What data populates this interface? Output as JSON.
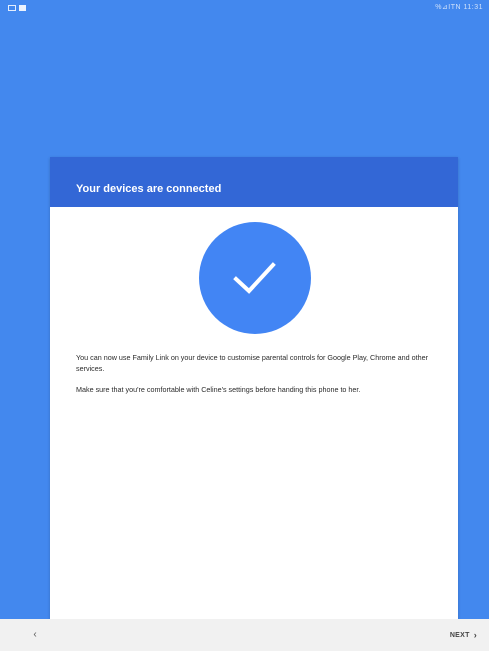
{
  "status_bar": {
    "right_text": "%⊿ITN 11:31",
    "left_icons": [
      "gallery-icon",
      "folder-icon"
    ]
  },
  "card": {
    "title": "Your devices are connected",
    "paragraph_1": "You can now use Family Link on your device to customise parental controls for Google Play, Chrome and other services.",
    "paragraph_2": "Make sure that you're comfortable with Celine's settings before handing this phone to her."
  },
  "bottom_bar": {
    "back_glyph": "‹",
    "next_label": "NEXT",
    "next_glyph": "›"
  },
  "colors": {
    "background": "#4388ee",
    "header": "#3367d6",
    "circle": "#4285f4",
    "bottom_bar": "#f1f1f1"
  }
}
